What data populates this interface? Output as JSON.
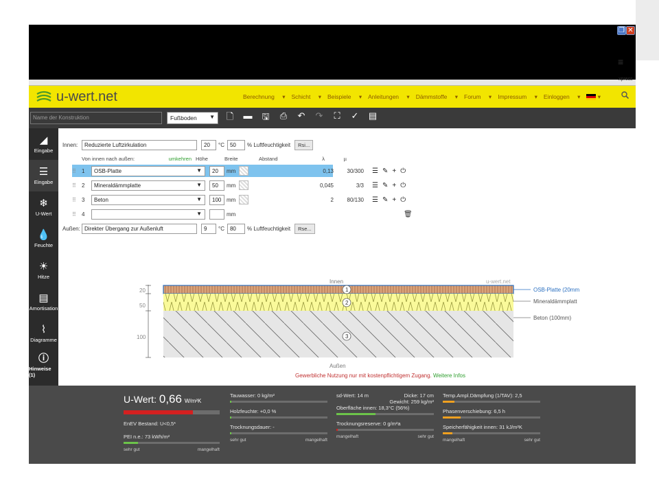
{
  "browser": {
    "menu_icon": "hamburger-icon",
    "extension_label": "xpress"
  },
  "header": {
    "logo_text": "u-wert.net",
    "nav": [
      "Berechnung",
      "Schicht",
      "Beispiele",
      "Anleitungen",
      "Dämmstoffe",
      "Forum",
      "Impressum",
      "Einloggen"
    ],
    "search_icon": "search-icon"
  },
  "toolbar": {
    "name_placeholder": "Name der Konstruktion",
    "type_value": "Fußboden"
  },
  "sidebar": {
    "items": [
      {
        "label": "Eingabe",
        "icon": "layers-icon"
      },
      {
        "label": "Eingabe",
        "icon": "input-icon"
      },
      {
        "label": "U-Wert",
        "icon": "thermometer-icon"
      },
      {
        "label": "Feuchte",
        "icon": "drop-icon"
      },
      {
        "label": "Hitze",
        "icon": "sun-icon"
      },
      {
        "label": "Amortisation",
        "icon": "coins-icon"
      },
      {
        "label": "Diagramme",
        "icon": "chart-icon"
      },
      {
        "label": "Hinweise (1)",
        "icon": "info-icon"
      }
    ]
  },
  "form": {
    "innen_label": "Innen:",
    "innen_value": "Reduzierte Luftzirkulation",
    "innen_temp": "20",
    "innen_temp_unit": "°C",
    "innen_humidity": "50",
    "humidity_label": "% Luftfeuchtigkeit",
    "rsi_button": "Rsi...",
    "col_header_layers": "Von innen nach außen:",
    "col_header_reverse": "umkehren",
    "col_header_height": "Höhe",
    "col_header_width": "Breite",
    "col_header_distance": "Abstand",
    "col_header_lambda": "λ",
    "col_header_mu": "µ",
    "layers": [
      {
        "num": "1",
        "material": "OSB-Platte",
        "thickness": "20",
        "unit": "mm",
        "lambda": "0,13",
        "mu": "30/300"
      },
      {
        "num": "2",
        "material": "Mineraldämmplatte",
        "thickness": "50",
        "unit": "mm",
        "lambda": "0,045",
        "mu": "3/3"
      },
      {
        "num": "3",
        "material": "Beton",
        "thickness": "100",
        "unit": "mm",
        "lambda": "2",
        "mu": "80/130"
      },
      {
        "num": "4",
        "material": "",
        "thickness": "",
        "unit": "mm",
        "lambda": "",
        "mu": ""
      }
    ],
    "aussen_label": "Außen:",
    "aussen_value": "Direkter Übergang zur Außenluft",
    "aussen_temp": "9",
    "aussen_temp_unit": "°C",
    "aussen_humidity": "80",
    "rse_button": "Rse..."
  },
  "diagram": {
    "innen_label": "Innen",
    "aussen_label": "Außen",
    "watermark": "u-wert.net",
    "dim_labels": [
      "20",
      "50",
      "100"
    ],
    "layer_labels": [
      "OSB-Platte (20mm",
      "Mineraldämmplatt",
      "Beton (100mm)"
    ],
    "layer_numbers": [
      "1",
      "2",
      "3"
    ],
    "notice": "Gewerbliche Nutzung nur mit kostenpflichtigem Zugang.",
    "notice_link": "Weitere Infos"
  },
  "results": {
    "uwert_label": "U-Wert:",
    "uwert_value": "0,66",
    "uwert_unit": "W/m²K",
    "enev": "EnEV Bestand: U<0,5*",
    "pei": "PEI n.e.: 73 kWh/m²",
    "scale_good": "sehr gut",
    "scale_bad": "mangelhaft",
    "tauwasser": "Tauwasser: 0 kg/m²",
    "holzfeuchte": "Holzfeuchte: +0,0 %",
    "trocknungsdauer": "Trocknungsdauer: -",
    "sd_wert": "sd-Wert: 14 m",
    "dicke": "Dicke: 17 cm",
    "gewicht": "Gewicht: 259 kg/m²",
    "oberflaeche": "Oberfläche innen: 18,3°C (56%)",
    "trocknungsreserve": "Trocknungsreserve: 0 g/m²a",
    "temp_amp": "Temp.Ampl.Dämpfung (1/TAV): 2,5",
    "phasen": "Phasenverschiebung: 6,5 h",
    "speicher": "Speicherfähigkeit innen: 31 kJ/m²K",
    "uwert_bar_fraction": 0.72,
    "pei_bar_fraction": 0.15,
    "colors": {
      "red": "#d42020",
      "green": "#6cc44a",
      "orange": "#f0a020"
    }
  }
}
